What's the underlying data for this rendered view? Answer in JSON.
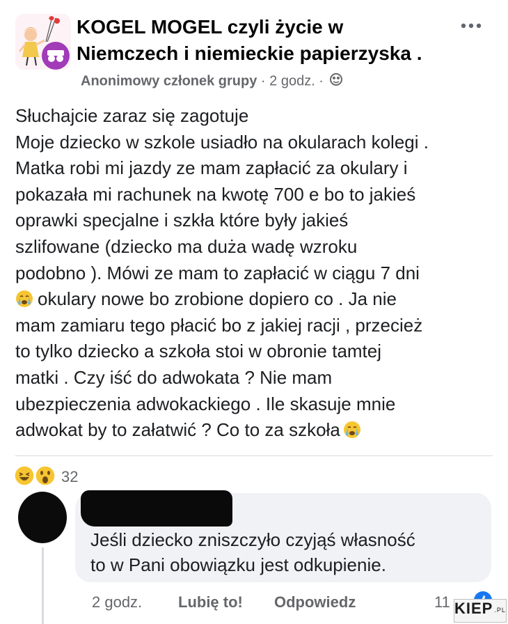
{
  "header": {
    "group_name_line1": "KOGEL MOGEL czyli życie w",
    "group_name_line2": "Niemczech i niemieckie papierzyska .",
    "more_icon": "more-horizontal-icon",
    "author": "Anonimowy członek grupy",
    "separator": " · ",
    "time": "2 godz.",
    "separator2": " · ",
    "privacy_icon": "globe-icon"
  },
  "post": {
    "lines": [
      "Słuchajcie zaraz się zagotuje",
      "Moje dziecko w szkole usiadło na okularach kolegi .",
      "Matka robi mi jazdy ze mam zapłacić za okulary i",
      "pokazała mi rachunek na kwotę 700 e bo to jakieś",
      "oprawki specjalne i szkła które były jakieś",
      "szlifowane (dziecko ma duża wadę wzroku",
      "podobno ). Mówi ze mam to zapłacić w ciągu 7 dni",
      "okulary nowe bo zrobione dopiero co . Ja nie",
      "mam zamiaru tego płacić bo z jakiej racji , przecież",
      "to tylko dziecko a szkoła stoi w obronie tamtej",
      "matki . Czy iść do adwokata ? Nie mam",
      "ubezpieczenia  adwokackiego . Ile skasuje mnie",
      "adwokat by to załatwić ? Co to za szkoła"
    ],
    "emoji": "crying-face-emoji"
  },
  "reactions": {
    "icons": [
      "haha-reaction-icon",
      "wow-reaction-icon"
    ],
    "count": "32"
  },
  "comment": {
    "text_line1": "Jeśli dziecko zniszczyło czyjąś własność",
    "text_line2": "to w Pani obowiązku jest odkupienie.",
    "time": "2 godz.",
    "like_label": "Lubię to!",
    "reply_label": "Odpowiedz",
    "reply_count": "11"
  },
  "watermark": {
    "text": "KIEP",
    "suffix": ".PL"
  },
  "colors": {
    "text": "#1c1e21",
    "secondary": "#65676b",
    "bubble": "#f0f2f5"
  }
}
